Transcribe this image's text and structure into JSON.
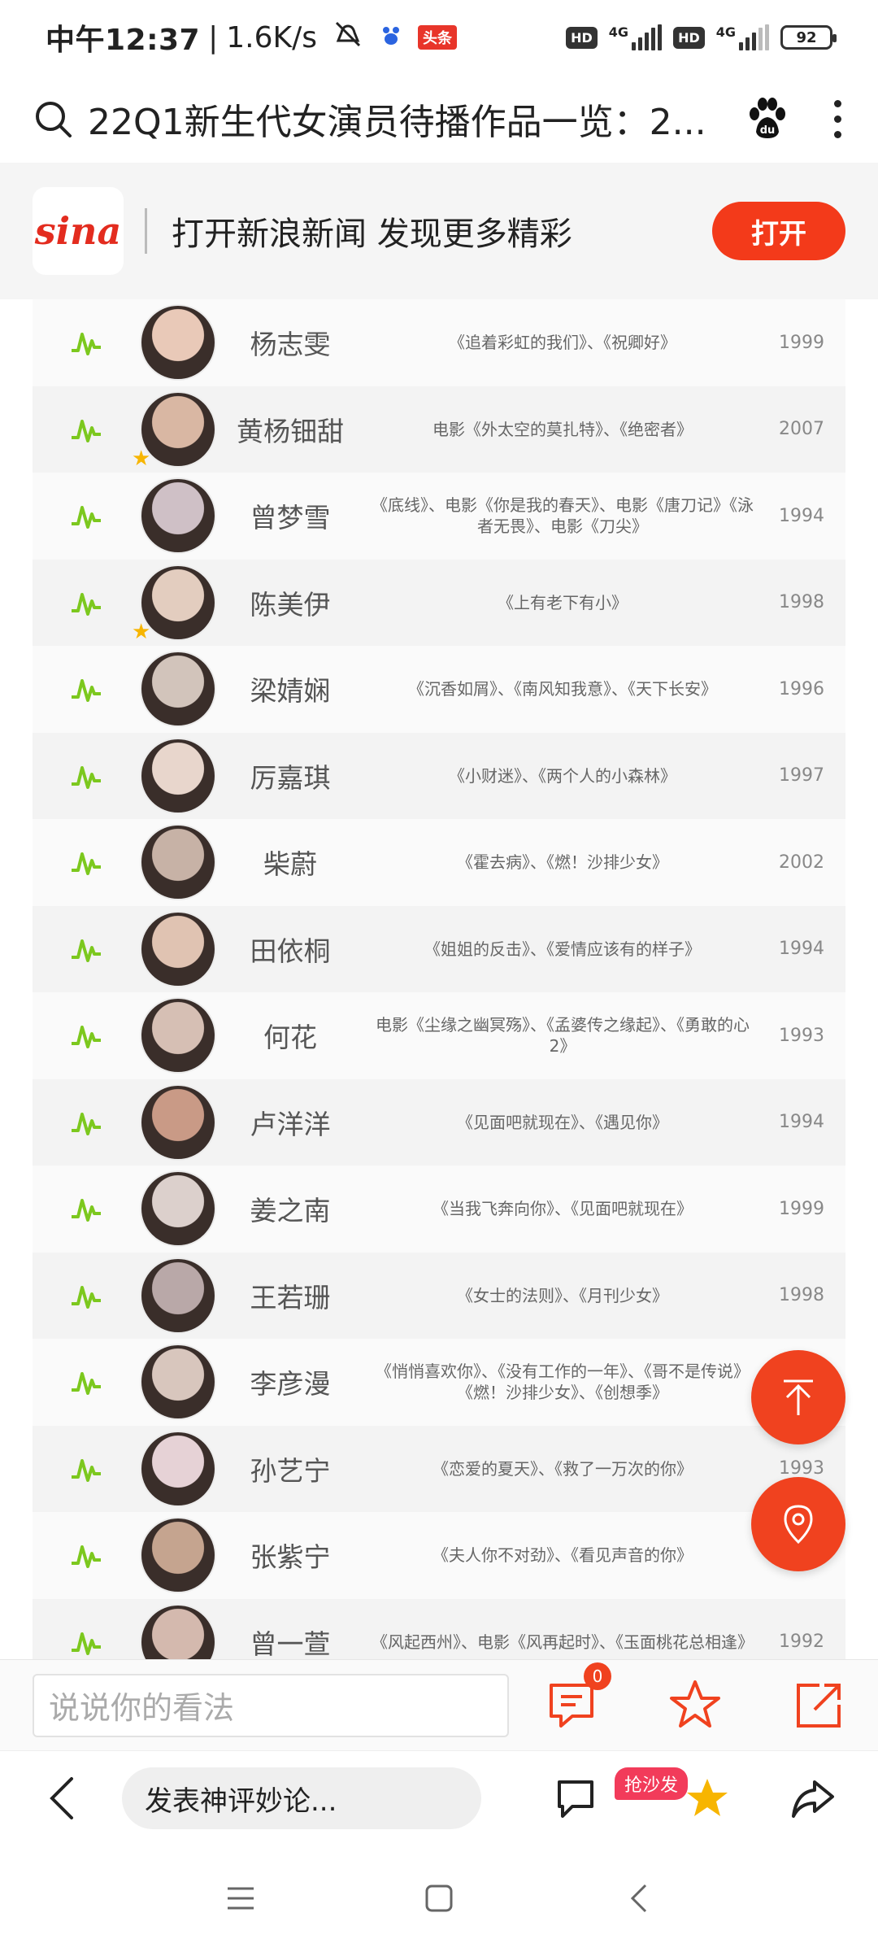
{
  "status_bar": {
    "time": "中午12:37",
    "speed": "1.6K/s",
    "app_badge": "头条",
    "hd1": "HD",
    "net1": "4G",
    "hd2": "HD",
    "net2": "4G",
    "battery": "92"
  },
  "address_bar": {
    "title": "22Q1新生代女演员待播作品一览：2..."
  },
  "banner": {
    "logo": "sina",
    "text": "打开新浪新闻 发现更多精彩",
    "open_label": "打开"
  },
  "table": {
    "rows": [
      {
        "name": "杨志雯",
        "works": "《追着彩虹的我们》、《祝卿好》",
        "year": "1999",
        "star": false
      },
      {
        "name": "黄杨钿甜",
        "works": "电影《外太空的莫扎特》、《绝密者》",
        "year": "2007",
        "star": true
      },
      {
        "name": "曾梦雪",
        "works": "《底线》、电影《你是我的春天》、电影《唐刀记》《泳者无畏》、电影《刀尖》",
        "year": "1994",
        "star": false
      },
      {
        "name": "陈美伊",
        "works": "《上有老下有小》",
        "year": "1998",
        "star": true
      },
      {
        "name": "梁婧娴",
        "works": "《沉香如屑》、《南风知我意》、《天下长安》",
        "year": "1996",
        "star": false
      },
      {
        "name": "厉嘉琪",
        "works": "《小财迷》、《两个人的小森林》",
        "year": "1997",
        "star": false
      },
      {
        "name": "柴蔚",
        "works": "《霍去病》、《燃！沙排少女》",
        "year": "2002",
        "star": false
      },
      {
        "name": "田依桐",
        "works": "《姐姐的反击》、《爱情应该有的样子》",
        "year": "1994",
        "star": false
      },
      {
        "name": "何花",
        "works": "电影《尘缘之幽冥殇》、《孟婆传之缘起》、《勇敢的心2》",
        "year": "1993",
        "star": false
      },
      {
        "name": "卢洋洋",
        "works": "《见面吧就现在》、《遇见你》",
        "year": "1994",
        "star": false
      },
      {
        "name": "姜之南",
        "works": "《当我飞奔向你》、《见面吧就现在》",
        "year": "1999",
        "star": false
      },
      {
        "name": "王若珊",
        "works": "《女士的法则》、《月刊少女》",
        "year": "1998",
        "star": false
      },
      {
        "name": "李彦漫",
        "works": "《悄悄喜欢你》、《没有工作的一年》、《哥不是传说》《燃！沙排少女》、《创想季》",
        "year": "",
        "star": false
      },
      {
        "name": "孙艺宁",
        "works": "《恋爱的夏天》、《救了一万次的你》",
        "year": "1993",
        "star": false
      },
      {
        "name": "张紫宁",
        "works": "《夫人你不对劲》、《看见声音的你》",
        "year": "",
        "star": false
      },
      {
        "name": "曾一萱",
        "works": "《风起西州》、电影《风再起时》、《玉面桃花总相逢》",
        "year": "1992",
        "star": false
      }
    ]
  },
  "comment_bar": {
    "placeholder": "说说你的看法",
    "comment_count": "0"
  },
  "bottom_bar": {
    "input_placeholder": "发表神评妙论...",
    "sofa_label": "抢沙发"
  },
  "colors": {
    "accent": "#f0421f",
    "trend_green": "#7cc81e",
    "star": "#f7b500"
  }
}
